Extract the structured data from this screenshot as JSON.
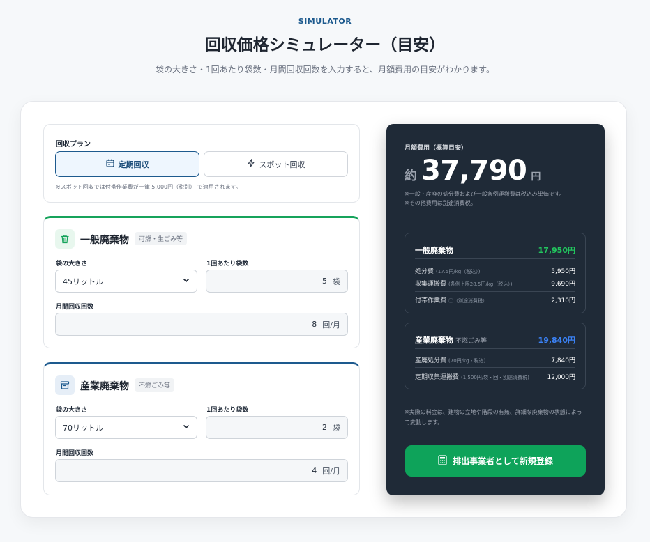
{
  "header": {
    "eyebrow": "SIMULATOR",
    "title": "回収価格シミュレーター（目安）",
    "subtitle": "袋の大きさ・1回あたり袋数・月間回収回数を入力すると、月額費用の目安がわかります。"
  },
  "plan": {
    "label": "回収プラン",
    "options": [
      {
        "label": "定期回収",
        "icon": "calendar-icon",
        "selected": true
      },
      {
        "label": "スポット回収",
        "icon": "lightning-icon",
        "selected": false
      }
    ],
    "note": "※スポット回収では付帯作業費が一律 5,000円（税別） で適用されます。"
  },
  "general": {
    "title": "一般廃棄物",
    "tag": "可燃・生ごみ等",
    "icon": "trash-icon",
    "accent": "#16a35b",
    "bag_size_label": "袋の大きさ",
    "bag_size_value": "45リットル",
    "bags_label": "1回あたり袋数",
    "bags_value": "5",
    "bags_unit": "袋",
    "freq_label": "月間回収回数",
    "freq_value": "8",
    "freq_unit": "回/月"
  },
  "industrial": {
    "title": "産業廃棄物",
    "tag": "不燃ごみ等",
    "icon": "archive-box-icon",
    "accent": "#1d5a8e",
    "bag_size_label": "袋の大きさ",
    "bag_size_value": "70リットル",
    "bags_label": "1回あたり袋数",
    "bags_value": "2",
    "bags_unit": "袋",
    "freq_label": "月間回収回数",
    "freq_value": "4",
    "freq_unit": "回/月"
  },
  "summary": {
    "heading": "月額費用（概算目安）",
    "prefix": "約",
    "amount": "37,790",
    "currency": "円",
    "note1": "※一般・産廃の処分費および一般条例運搬費は税込み単価です。",
    "note2": "※その他費用は別途消費税。",
    "general": {
      "name": "一般廃棄物",
      "total": "17,950円",
      "rows": [
        {
          "label": "処分費",
          "detail": "(17.5円/kg（税込）)",
          "value": "5,950円"
        },
        {
          "label": "収集運搬費",
          "detail": "(条例上限28.5円/kg（税込）)",
          "value": "9,690円"
        },
        {
          "label": "付帯作業費",
          "detail": "ⓘ（別途消費税）",
          "value": "2,310円"
        }
      ]
    },
    "industrial": {
      "name": "産業廃棄物",
      "name_sub": "不燃ごみ等",
      "total": "19,840円",
      "rows": [
        {
          "label": "産廃処分費",
          "detail": "(70円/kg・税込)",
          "value": "7,840円"
        },
        {
          "label": "定期収集運搬費",
          "detail": "(1,500円/袋・回・別途消費税)",
          "value": "12,000円"
        }
      ]
    },
    "footnote": "※実際の料金は、建物の立地や階段の有無、詳細な廃棄物の状態によって変動します。",
    "cta_label": "排出事業者として新規登録",
    "cta_icon": "calculator-icon",
    "accent_green": "#22c55e",
    "accent_blue": "#3b82f6"
  }
}
